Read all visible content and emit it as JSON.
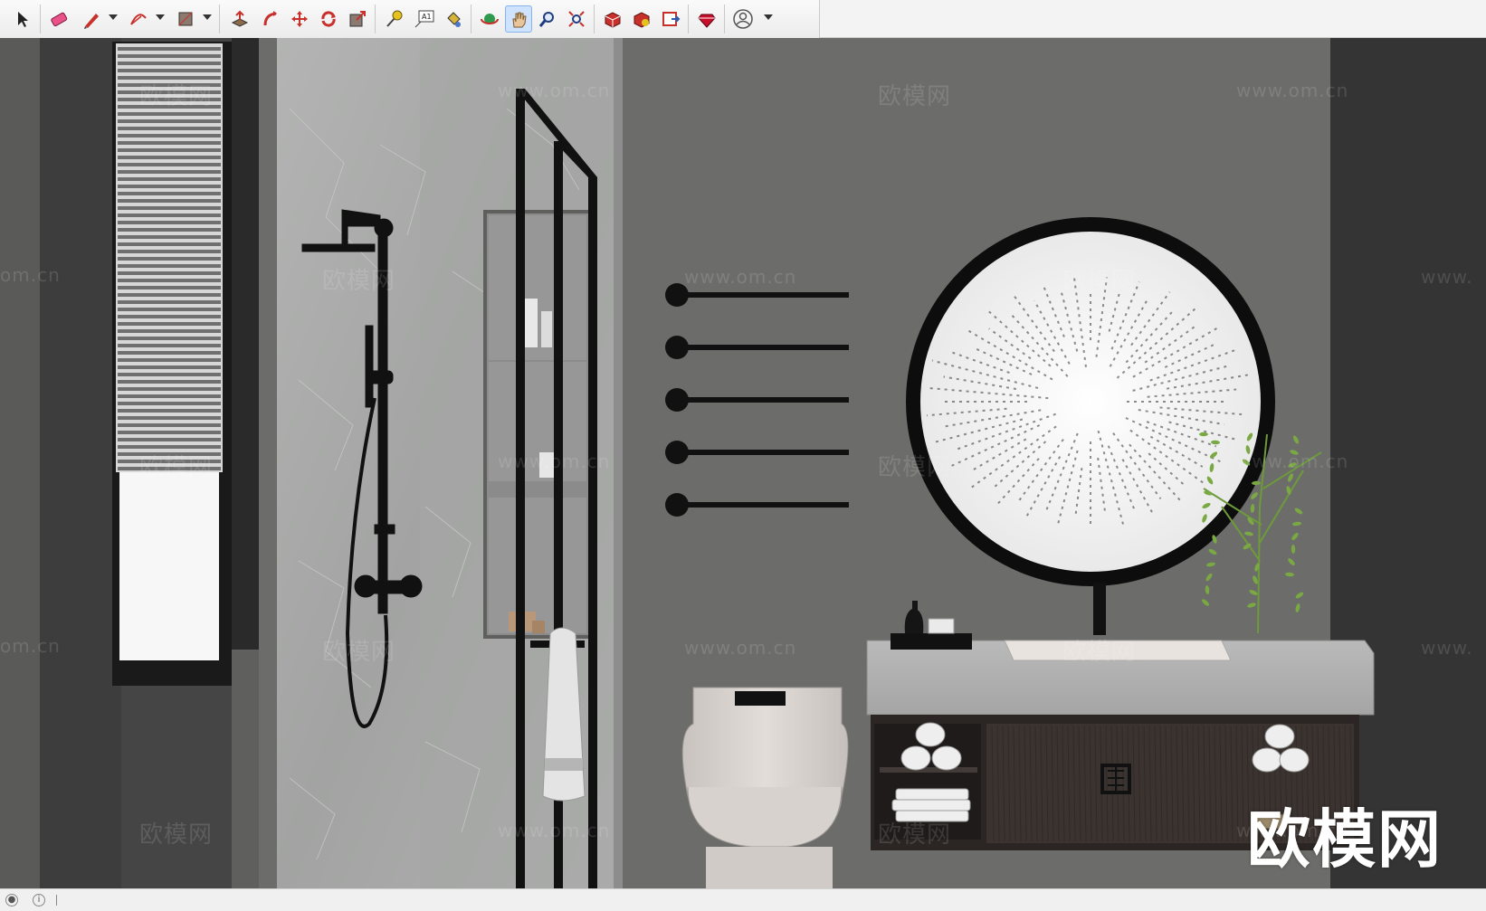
{
  "toolbar": {
    "tools": [
      {
        "name": "select-tool",
        "icon": "arrow-cursor-icon"
      },
      {
        "name": "eraser-tool",
        "icon": "eraser-icon"
      },
      {
        "name": "line-tool",
        "icon": "pencil-icon"
      },
      {
        "name": "arc-tool",
        "icon": "arc-icon"
      },
      {
        "name": "rectangle-tool",
        "icon": "rectangle-icon"
      },
      {
        "name": "push-pull-tool",
        "icon": "push-pull-icon"
      },
      {
        "name": "follow-me-tool",
        "icon": "follow-me-icon"
      },
      {
        "name": "move-tool",
        "icon": "move-icon"
      },
      {
        "name": "rotate-tool",
        "icon": "rotate-icon"
      },
      {
        "name": "scale-tool",
        "icon": "scale-icon"
      },
      {
        "name": "tape-measure-tool",
        "icon": "tape-measure-icon"
      },
      {
        "name": "text-tool",
        "icon": "text-label-icon"
      },
      {
        "name": "paint-bucket-tool",
        "icon": "paint-bucket-icon"
      },
      {
        "name": "orbit-tool",
        "icon": "orbit-icon"
      },
      {
        "name": "pan-tool",
        "icon": "hand-icon"
      },
      {
        "name": "zoom-tool",
        "icon": "magnifier-icon"
      },
      {
        "name": "zoom-extents-tool",
        "icon": "zoom-extents-icon"
      },
      {
        "name": "3d-warehouse-tool",
        "icon": "warehouse-icon"
      },
      {
        "name": "extension-warehouse-tool",
        "icon": "extension-icon"
      },
      {
        "name": "layout-tool",
        "icon": "layout-icon"
      },
      {
        "name": "ruby-console-tool",
        "icon": "ruby-icon"
      },
      {
        "name": "account-tool",
        "icon": "user-account-icon"
      }
    ],
    "text_tool_glyph": "A1"
  },
  "watermarks": {
    "cn": "欧模网",
    "url": "www.om.cn",
    "url_partial_left": "om.cn",
    "url_partial_right": "www."
  },
  "brand_logo": "欧模网",
  "colors": {
    "wall": "#6c6d6a",
    "dark_wall": "#3a3b3a",
    "marble": "#a9aaa9",
    "black_frame": "#111111",
    "toolbar_bg": "#f3f3f3",
    "active_tool": "#cfe3ff"
  }
}
